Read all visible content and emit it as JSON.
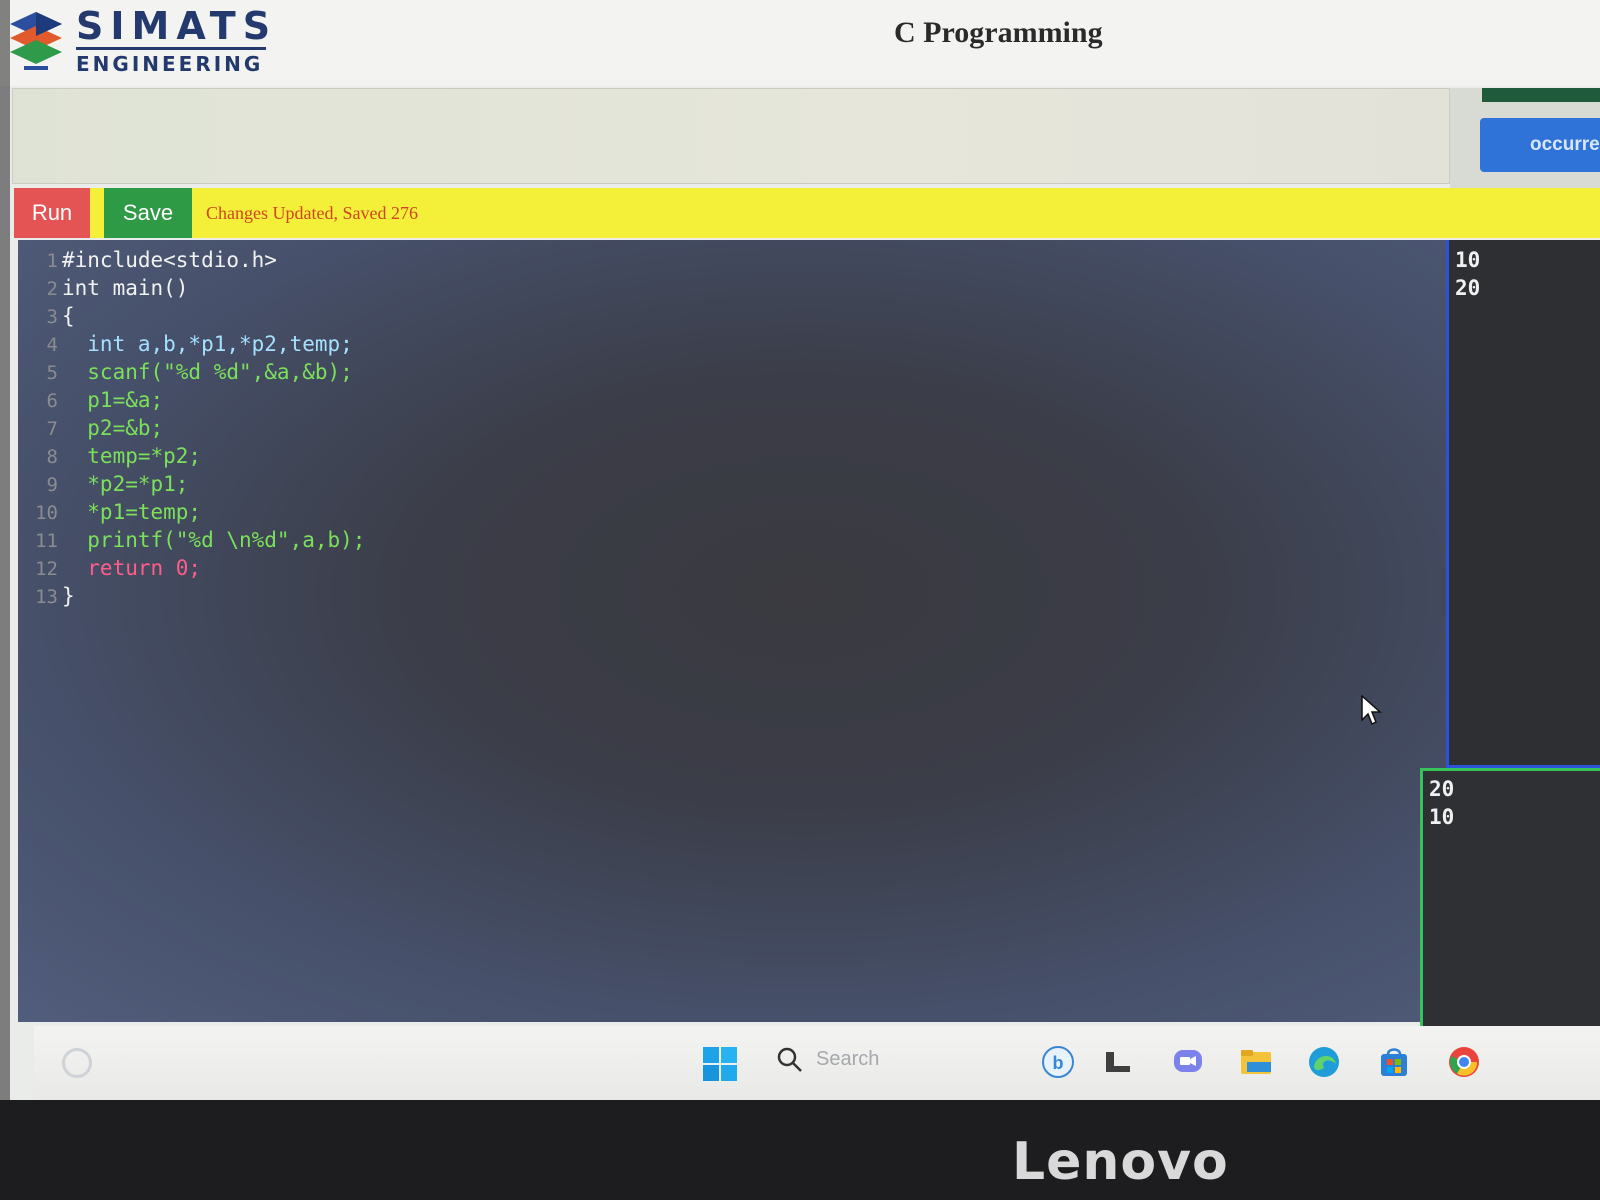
{
  "header": {
    "brand_top": "SIMATS",
    "brand_bottom": "ENGINEERING",
    "page_title": "C Programming"
  },
  "question_panel": {
    "side_button_label": "occurren"
  },
  "toolbar": {
    "run_label": "Run",
    "save_label": "Save",
    "status": "Changes Updated, Saved 276"
  },
  "editor": {
    "lines": [
      {
        "num": "1",
        "code": "#include<stdio.h>"
      },
      {
        "num": "2",
        "code": "int main()"
      },
      {
        "num": "3",
        "code": "{"
      },
      {
        "num": "4",
        "code": "  int a,b,*p1,*p2,temp;"
      },
      {
        "num": "5",
        "code": "  scanf(\"%d %d\",&a,&b);"
      },
      {
        "num": "6",
        "code": "  p1=&a;"
      },
      {
        "num": "7",
        "code": "  p2=&b;"
      },
      {
        "num": "8",
        "code": "  temp=*p2;"
      },
      {
        "num": "9",
        "code": "  *p2=*p1;"
      },
      {
        "num": "10",
        "code": "  *p1=temp;"
      },
      {
        "num": "11",
        "code": "  printf(\"%d \\n%d\",a,b);"
      },
      {
        "num": "12",
        "code": "  return 0;"
      },
      {
        "num": "13",
        "code": "}"
      }
    ]
  },
  "output": {
    "input_lines": [
      "10",
      "20"
    ],
    "result_lines": [
      "20",
      "10"
    ]
  },
  "taskbar": {
    "search_placeholder": "Search"
  },
  "monitor": {
    "brand": "Lenovo"
  },
  "colors": {
    "run": "#e45454",
    "save": "#2e9a45",
    "toolbar": "#f4f03a",
    "status_text": "#d0451f",
    "output_border_1": "#2c52d9",
    "output_border_2": "#36c35a"
  }
}
